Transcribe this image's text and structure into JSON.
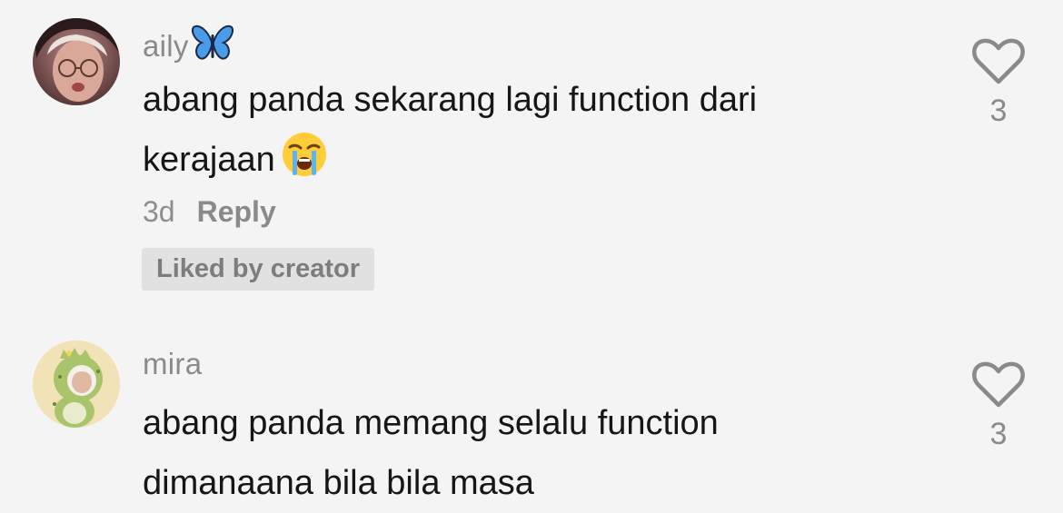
{
  "comments": [
    {
      "username": "aily",
      "username_icon": "butterfly-icon",
      "text_line1": "abang panda sekarang lagi function dari",
      "text_line2": "kerajaan",
      "text_emoji": "loudly-crying-face-icon",
      "time": "3d",
      "reply_label": "Reply",
      "liked_badge": "Liked by creator",
      "like_count": "3"
    },
    {
      "username": "mira",
      "text_line1": "abang panda memang selalu function",
      "text_line2": "dimanaana bila bila masa",
      "like_count": "3"
    }
  ],
  "colors": {
    "background": "#f4f4f4",
    "text": "#161616",
    "muted": "#8a8a8a",
    "badge_bg": "#e1e1e1"
  }
}
